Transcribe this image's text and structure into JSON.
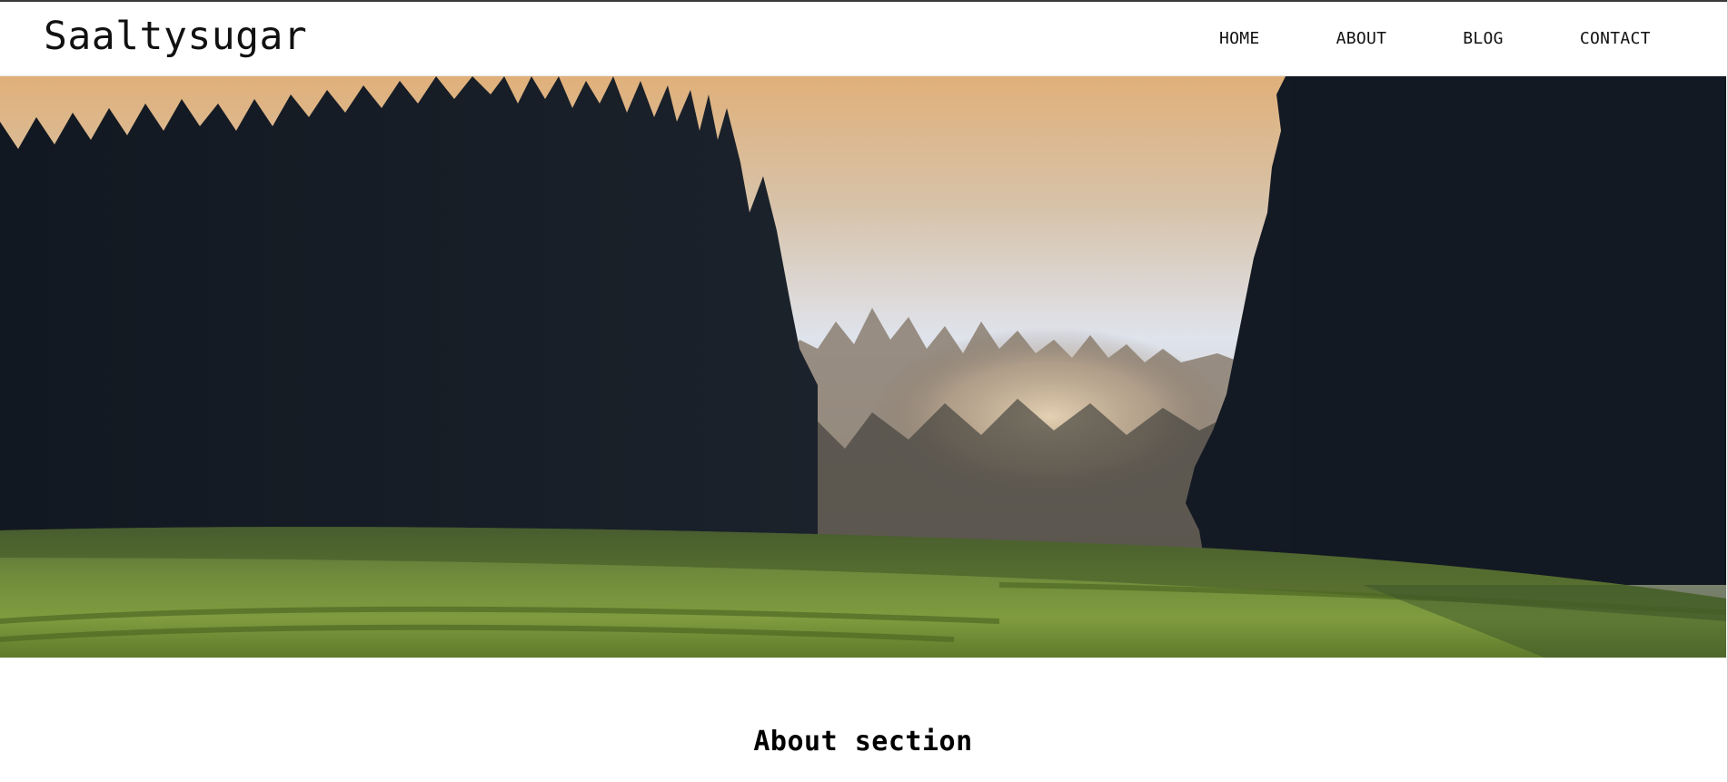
{
  "brand": {
    "name": "Saaltysugar"
  },
  "nav": {
    "items": [
      {
        "label": "HOME"
      },
      {
        "label": "ABOUT"
      },
      {
        "label": "BLOG"
      },
      {
        "label": "CONTACT"
      }
    ]
  },
  "hero": {
    "image": "misty-forest-meadow-photo",
    "colors": {
      "sky_top": "#e2b37f",
      "sky_mid": "#c9c0c0",
      "sky_pale": "#dfe3ec",
      "fog": "#d9c3a5",
      "dark_trees": "#151b24",
      "grass_light": "#7f9a3f",
      "grass_dark": "#43591f"
    }
  },
  "about": {
    "title": "About section"
  }
}
